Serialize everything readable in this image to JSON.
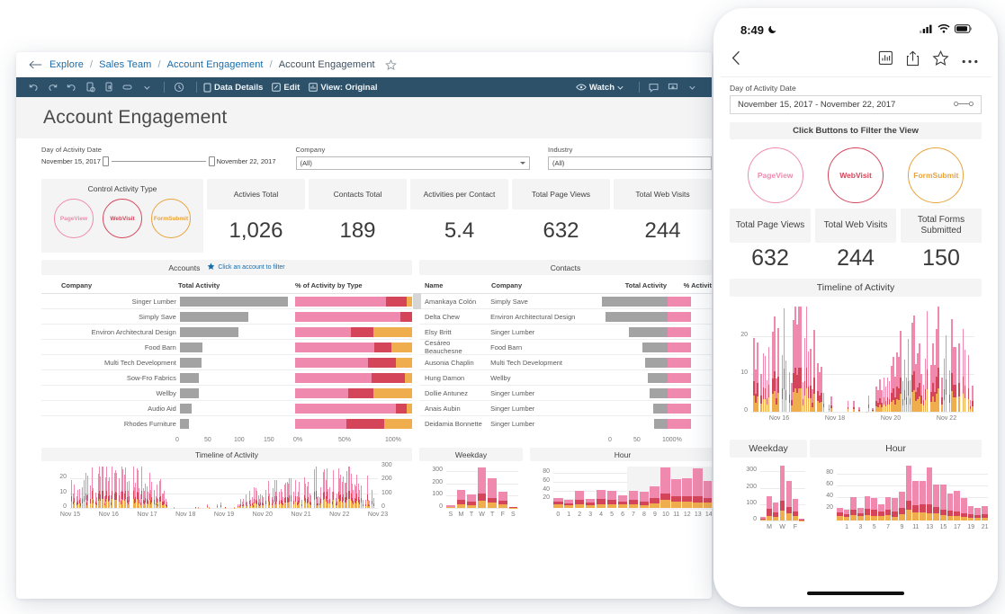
{
  "desktop": {
    "breadcrumb": {
      "back_icon": "back-arrow-icon",
      "items": [
        "Explore",
        "Sales Team",
        "Account Engagement",
        "Account Engagement"
      ],
      "separator": "/",
      "favorite_icon": "star-outline-icon"
    },
    "toolbar": {
      "icons": [
        "undo-icon",
        "redo-icon",
        "revert-icon",
        "refresh-data-icon",
        "pause-auto-update-icon",
        "alerts-icon",
        "dropdown-caret-icon",
        "ask-data-icon"
      ],
      "data_details_label": "Data Details",
      "data_details_icon": "data-details-icon",
      "edit_label": "Edit",
      "edit_icon": "edit-icon",
      "view_label": "View: Original",
      "view_icon": "view-icon",
      "watch_label": "Watch",
      "watch_icon": "eye-icon",
      "comment_icon": "comment-icon",
      "download_icon": "download-icon"
    },
    "title": "Account Engagement",
    "filters": {
      "date": {
        "label": "Day of Activity Date",
        "start": "November 15, 2017",
        "end": "November 22, 2017"
      },
      "company": {
        "label": "Company",
        "value": "(All)"
      },
      "industry": {
        "label": "Industry",
        "value": "(All)"
      }
    },
    "control_card": {
      "title": "Control Activity Type",
      "buttons": [
        {
          "label": "PageView",
          "color": "#ef8aae"
        },
        {
          "label": "WebVisit",
          "color": "#d4455a"
        },
        {
          "label": "FormSubmit",
          "color": "#e8a33d"
        }
      ]
    },
    "kpis": [
      {
        "label": "Activies Total",
        "value": "1,026"
      },
      {
        "label": "Contacts Total",
        "value": "189"
      },
      {
        "label": "Activities per Contact",
        "value": "5.4"
      },
      {
        "label": "Total Page Views",
        "value": "632"
      },
      {
        "label": "Total Web Visits",
        "value": "244"
      }
    ],
    "accounts": {
      "title": "Accounts",
      "action": "Click an account to filter",
      "action_icon": "star-filled-icon",
      "columns": [
        "Company",
        "Total Activity",
        "% of Activity by Type"
      ],
      "activity_axis_ticks": [
        "0",
        "50",
        "100",
        "150"
      ],
      "pct_axis_ticks": [
        "0%",
        "50%",
        "100%"
      ],
      "rows": [
        {
          "company": "Singer Lumber",
          "total": 162,
          "pct": [
            78,
            17,
            5
          ]
        },
        {
          "company": "Simply Save",
          "total": 103,
          "pct": [
            90,
            10,
            0
          ]
        },
        {
          "company": "Environ Architectural Design",
          "total": 88,
          "pct": [
            48,
            19,
            33
          ]
        },
        {
          "company": "Food Barn",
          "total": 34,
          "pct": [
            68,
            14,
            18
          ]
        },
        {
          "company": "Multi Tech Development",
          "total": 32,
          "pct": [
            62,
            24,
            14
          ]
        },
        {
          "company": "Sow-Fro Fabrics",
          "total": 28,
          "pct": [
            65,
            29,
            6
          ]
        },
        {
          "company": "Wellby",
          "total": 28,
          "pct": [
            45,
            22,
            33
          ]
        },
        {
          "company": "Audio Aid",
          "total": 18,
          "pct": [
            86,
            9,
            5
          ]
        },
        {
          "company": "Rhodes Furniture",
          "total": 13,
          "pct": [
            44,
            32,
            24
          ]
        }
      ]
    },
    "contacts": {
      "title": "Contacts",
      "columns": [
        "Name",
        "Company",
        "Total Activity",
        "% Activit"
      ],
      "axis_ticks": [
        "0",
        "50",
        "1000%"
      ],
      "rows": [
        {
          "name": "Amankaya Colón",
          "company": "Simply Save",
          "total": 64
        },
        {
          "name": "Delta Chew",
          "company": "Environ Architectural Design",
          "total": 60
        },
        {
          "name": "Elsy Britt",
          "company": "Singer Lumber",
          "total": 37
        },
        {
          "name": "Cesáreo Beauchesne",
          "company": "Food Barn",
          "total": 24
        },
        {
          "name": "Ausonia Chaplin",
          "company": "Multi Tech Development",
          "total": 22
        },
        {
          "name": "Hung Damon",
          "company": "Wellby",
          "total": 19
        },
        {
          "name": "Dollie Antunez",
          "company": "Singer Lumber",
          "total": 17
        },
        {
          "name": "Anais Aubin",
          "company": "Singer Lumber",
          "total": 14
        },
        {
          "name": "Deidamia Bonnette",
          "company": "Singer Lumber",
          "total": 13
        }
      ]
    },
    "timeline": {
      "title": "Timeline of Activity",
      "y_ticks": [
        "0",
        "10",
        "20"
      ],
      "x_ticks": [
        "Nov 15",
        "Nov 16",
        "Nov 17",
        "Nov 18",
        "Nov 19",
        "Nov 20",
        "Nov 21",
        "Nov 22",
        "Nov 23"
      ],
      "right_y_ticks": [
        "0",
        "100",
        "200",
        "300"
      ]
    },
    "weekday": {
      "title": "Weekday",
      "y_ticks": [
        "0",
        "100",
        "200",
        "300"
      ],
      "x_ticks": [
        "S",
        "M",
        "T",
        "W",
        "T",
        "F",
        "S"
      ]
    },
    "hour": {
      "title": "Hour",
      "y_ticks": [
        "20",
        "40",
        "60",
        "80"
      ],
      "x_ticks": [
        "0",
        "1",
        "2",
        "3",
        "4",
        "5",
        "6",
        "7",
        "8",
        "9",
        "10",
        "11",
        "12",
        "13",
        "14"
      ]
    }
  },
  "phone": {
    "status": {
      "time": "8:49",
      "dnd_icon": "moon-icon",
      "signal_icon": "cellular-signal-icon",
      "wifi_icon": "wifi-icon",
      "battery_icon": "battery-icon"
    },
    "nav": {
      "back_icon": "chevron-left-icon",
      "chart_icon": "view-data-icon",
      "share_icon": "share-icon",
      "favorite_icon": "star-outline-icon",
      "more_icon": "more-ellipsis-icon"
    },
    "filter": {
      "label": "Day of Activity Date",
      "value": "November 15, 2017 - November 22, 2017",
      "slider_icon": "range-slider-icon"
    },
    "band": "Click Buttons to Filter the View",
    "buttons": [
      {
        "label": "PageView",
        "color": "#ef8aae"
      },
      {
        "label": "WebVisit",
        "color": "#d4455a"
      },
      {
        "label": "FormSubmit",
        "color": "#e8a33d"
      }
    ],
    "kpis": [
      {
        "label": "Total Page Views",
        "value": "632"
      },
      {
        "label": "Total Web Visits",
        "value": "244"
      },
      {
        "label": "Total Forms Submitted",
        "value": "150"
      }
    ],
    "timeline": {
      "title": "Timeline of Activity",
      "y_ticks": [
        "0",
        "10",
        "20"
      ],
      "x_ticks": [
        "Nov 16",
        "Nov 18",
        "Nov 20",
        "Nov 22"
      ]
    },
    "weekday": {
      "title": "Weekday",
      "y_ticks": [
        "0",
        "100",
        "200",
        "300"
      ],
      "x_ticks": [
        "M",
        "W",
        "F"
      ]
    },
    "hour": {
      "title": "Hour",
      "y_ticks": [
        "20",
        "40",
        "60",
        "80"
      ],
      "x_ticks": [
        "1",
        "3",
        "5",
        "7",
        "9",
        "11",
        "13",
        "15",
        "17",
        "19",
        "21"
      ]
    }
  },
  "chart_data": {
    "accounts_total_activity": {
      "type": "bar",
      "title": "Total Activity",
      "categories": [
        "Singer Lumber",
        "Simply Save",
        "Environ Architectural Design",
        "Food Barn",
        "Multi Tech Development",
        "Sow-Fro Fabrics",
        "Wellby",
        "Audio Aid",
        "Rhodes Furniture"
      ],
      "values": [
        162,
        103,
        88,
        34,
        32,
        28,
        28,
        18,
        13
      ],
      "xlim": [
        0,
        175
      ],
      "color": "#a3a3a3",
      "orientation": "horizontal"
    },
    "accounts_pct_by_type": {
      "type": "bar",
      "title": "% of Activity by Type",
      "categories": [
        "Singer Lumber",
        "Simply Save",
        "Environ Architectural Design",
        "Food Barn",
        "Multi Tech Development",
        "Sow-Fro Fabrics",
        "Wellby",
        "Audio Aid",
        "Rhodes Furniture"
      ],
      "series": [
        {
          "name": "PageView",
          "color": "#ef8aae",
          "values": [
            78,
            90,
            48,
            68,
            62,
            65,
            45,
            86,
            44
          ]
        },
        {
          "name": "WebVisit",
          "color": "#d4455a",
          "values": [
            17,
            10,
            19,
            14,
            24,
            29,
            22,
            9,
            32
          ]
        },
        {
          "name": "FormSubmit",
          "color": "#e8a33d",
          "values": [
            5,
            0,
            33,
            18,
            14,
            6,
            33,
            5,
            24
          ]
        }
      ],
      "stacked": true,
      "xlim": [
        0,
        100
      ],
      "orientation": "horizontal"
    },
    "contacts_total_activity": {
      "type": "bar",
      "title": "Total Activity",
      "categories": [
        "Amankaya Colón",
        "Delta Chew",
        "Elsy Britt",
        "Cesáreo Beauchesne",
        "Ausonia Chaplin",
        "Hung Damon",
        "Dollie Antunez",
        "Anais Aubin",
        "Deidamia Bonnette"
      ],
      "values": [
        64,
        60,
        37,
        24,
        22,
        19,
        17,
        14,
        13
      ],
      "xlim": [
        0,
        70
      ],
      "color": "#a3a3a3",
      "orientation": "horizontal"
    },
    "weekday": {
      "type": "bar",
      "title": "Weekday",
      "categories": [
        "S",
        "M",
        "T",
        "W",
        "T",
        "F",
        "S"
      ],
      "series": [
        {
          "name": "FormSubmit",
          "color": "#f0ad4e",
          "values": [
            4,
            28,
            22,
            62,
            44,
            26,
            2
          ]
        },
        {
          "name": "WebVisit",
          "color": "#d4455a",
          "values": [
            6,
            42,
            30,
            60,
            38,
            30,
            3
          ]
        },
        {
          "name": "PageView",
          "color": "#ef8aae",
          "values": [
            12,
            80,
            58,
            210,
            160,
            76,
            5
          ]
        }
      ],
      "stacked": true,
      "ylim": [
        0,
        340
      ],
      "ylabel": "",
      "y_ticks": [
        0,
        100,
        200,
        300
      ]
    },
    "hour": {
      "type": "bar",
      "title": "Hour",
      "categories": [
        "0",
        "1",
        "2",
        "3",
        "4",
        "5",
        "6",
        "7",
        "8",
        "9",
        "10",
        "11",
        "12",
        "13",
        "14",
        "15",
        "16",
        "17",
        "18",
        "19",
        "20",
        "21"
      ],
      "series": [
        {
          "name": "FormSubmit",
          "color": "#f0ad4e",
          "values": [
            8,
            6,
            9,
            7,
            9,
            8,
            8,
            9,
            6,
            10,
            18,
            14,
            14,
            13,
            12,
            9,
            8,
            7,
            6,
            5,
            4,
            5
          ]
        },
        {
          "name": "WebVisit",
          "color": "#d4455a",
          "values": [
            6,
            5,
            10,
            6,
            11,
            10,
            7,
            10,
            9,
            12,
            16,
            12,
            13,
            14,
            11,
            10,
            9,
            9,
            7,
            6,
            5,
            6
          ]
        },
        {
          "name": "PageView",
          "color": "#ef8aae",
          "values": [
            8,
            7,
            21,
            8,
            21,
            21,
            13,
            21,
            23,
            27,
            59,
            41,
            41,
            64,
            39,
            43,
            29,
            35,
            25,
            13,
            13,
            14
          ]
        }
      ],
      "stacked": true,
      "ylim": [
        0,
        95
      ],
      "y_ticks": [
        20,
        40,
        60,
        80
      ]
    },
    "timeline": {
      "type": "bar",
      "title": "Timeline of Activity",
      "xlabel": "Day of Activity Date",
      "x_range": [
        "Nov 15",
        "Nov 23"
      ],
      "ylim": [
        0,
        28
      ],
      "y_ticks": [
        0,
        10,
        20
      ],
      "right_ylim": [
        0,
        300
      ],
      "right_y_ticks": [
        0,
        100,
        200,
        300
      ],
      "series": [
        {
          "name": "PageView",
          "color": "#ef8aae"
        },
        {
          "name": "WebVisit",
          "color": "#d4455a"
        },
        {
          "name": "FormSubmit",
          "color": "#f0ad4e"
        }
      ],
      "note": "Dense per-hour stacked bars across Nov 15 - Nov 23; peaks up to 27 on Nov 16-17 and 24 on Nov 22; gaps on Nov 18-19 (weekend)."
    }
  }
}
